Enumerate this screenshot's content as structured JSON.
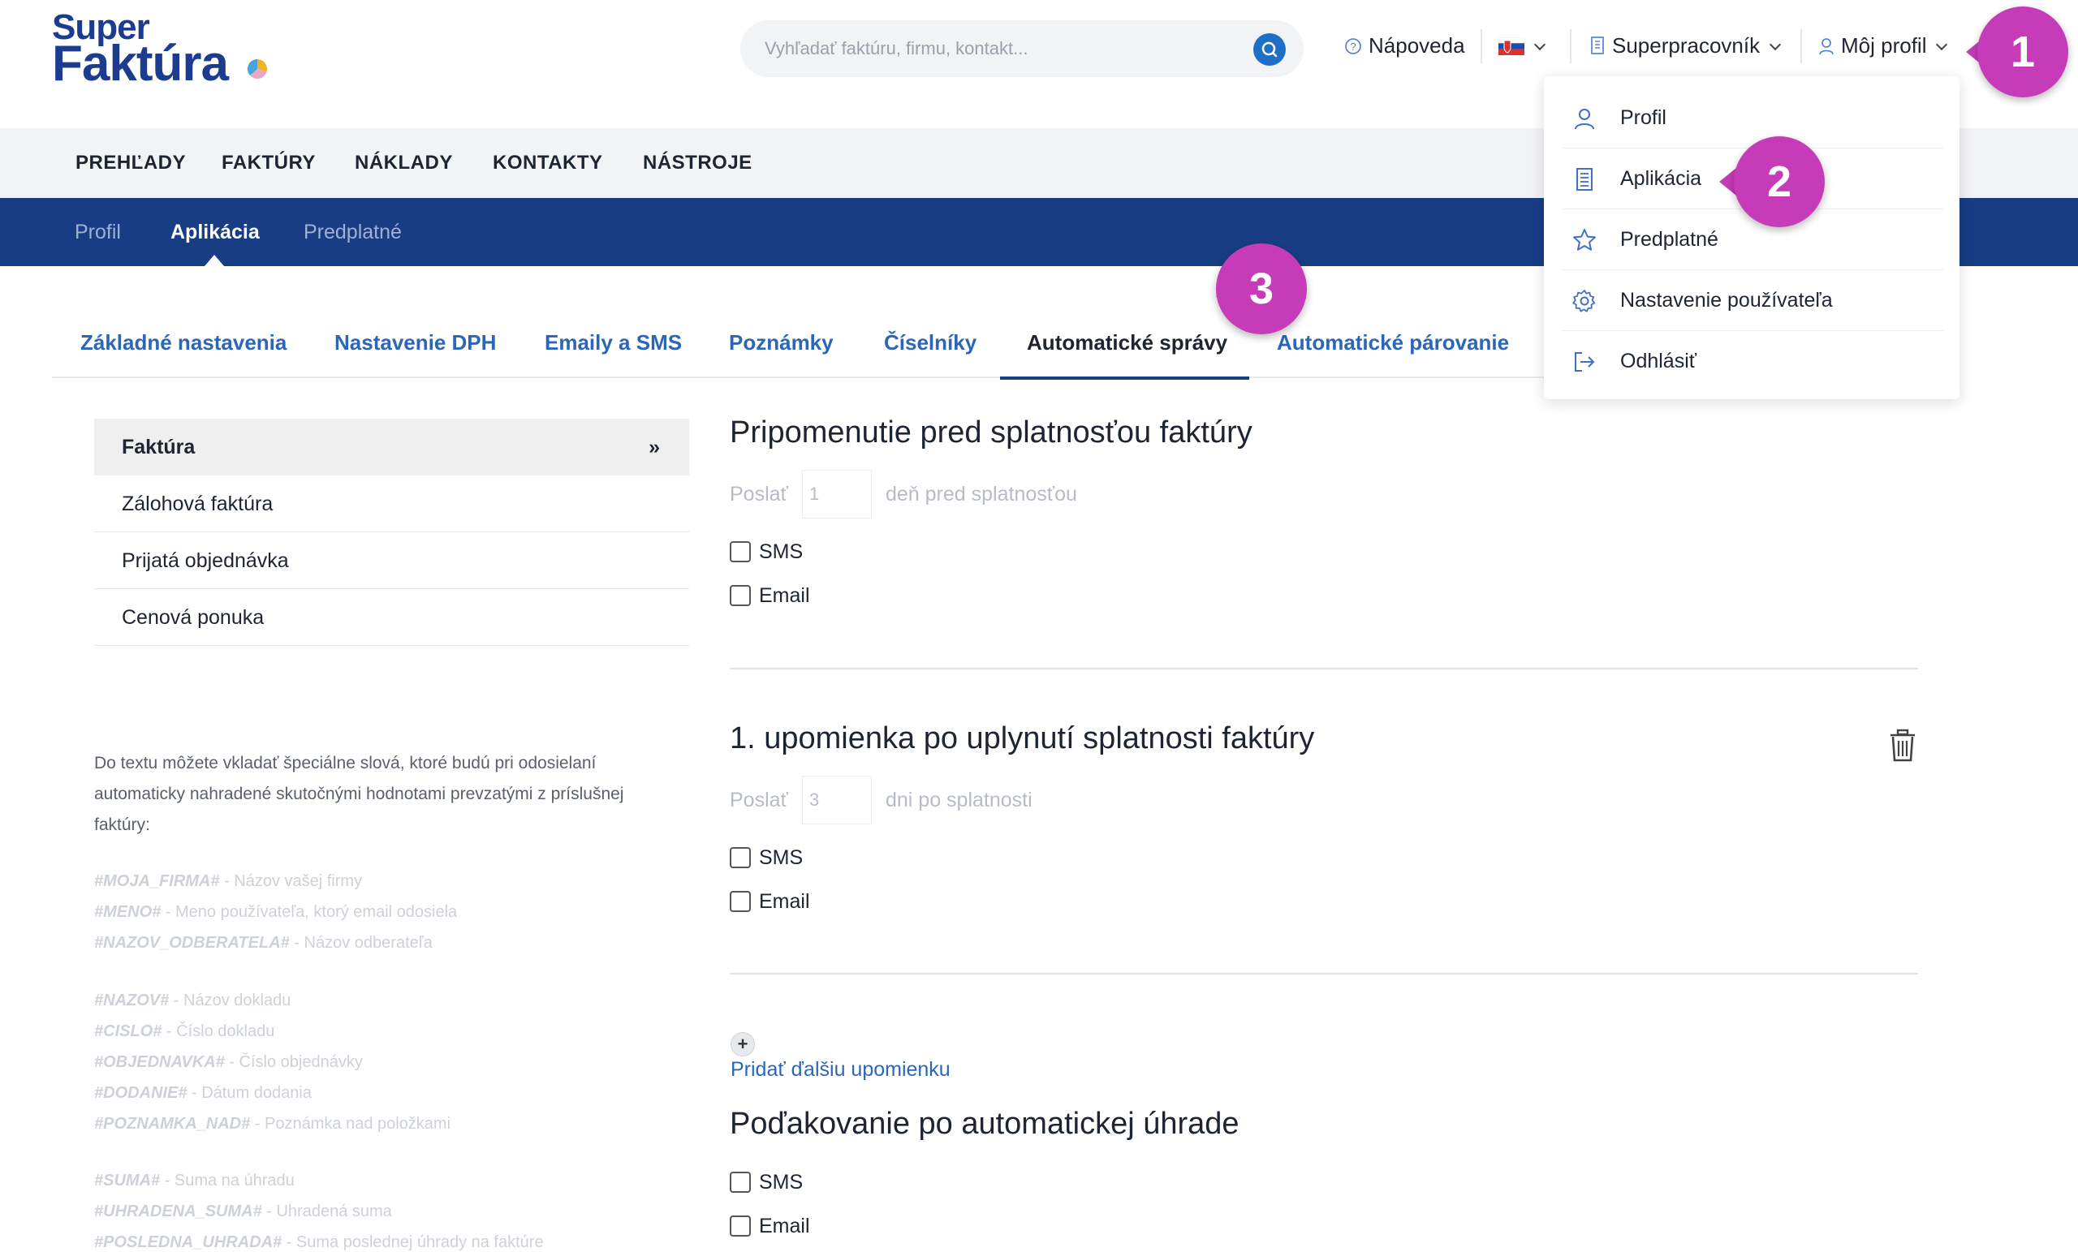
{
  "logo": {
    "line1": "Super",
    "line2": "Faktúra"
  },
  "search": {
    "placeholder": "Vyhľadať faktúru, firmu, kontakt..."
  },
  "header": {
    "help_label": "Nápoveda",
    "role_label": "Superpracovník",
    "profile_label": "Môj profil"
  },
  "main_nav": [
    "PREHĽADY",
    "FAKTÚRY",
    "NÁKLADY",
    "KONTAKTY",
    "NÁSTROJE"
  ],
  "sub_nav": [
    "Profil",
    "Aplikácia",
    "Predplatné"
  ],
  "tabs": [
    "Základné nastavenia",
    "Nastavenie DPH",
    "Emaily a SMS",
    "Poznámky",
    "Číselníky",
    "Automatické správy",
    "Automatické párovanie"
  ],
  "left_menu": {
    "items": [
      "Faktúra",
      "Zálohová faktúra",
      "Prijatá objednávka",
      "Cenová ponuka"
    ],
    "active_arrow": "»"
  },
  "help_text": "Do textu môžete vkladať špeciálne slová, ktoré budú pri odosielaní automaticky nahradené skutočnými hodnotami prevzatými z príslušnej faktúry:",
  "variables": [
    {
      "tag": "#MOJA_FIRMA#",
      "desc": " - Názov vašej firmy"
    },
    {
      "tag": "#MENO#",
      "desc": " - Meno používateľa, ktorý email odosiela"
    },
    {
      "tag": "#NAZOV_ODBERATELA#",
      "desc": " - Názov odberateľa"
    },
    {
      "tag": "#NAZOV#",
      "desc": " - Názov dokladu"
    },
    {
      "tag": "#CISLO#",
      "desc": " - Číslo dokladu"
    },
    {
      "tag": "#OBJEDNAVKA#",
      "desc": " - Číslo objednávky"
    },
    {
      "tag": "#DODANIE#",
      "desc": " - Dátum dodania"
    },
    {
      "tag": "#POZNAMKA_NAD#",
      "desc": " - Poznámka nad položkami"
    },
    {
      "tag": "#SUMA#",
      "desc": " - Suma na úhradu"
    },
    {
      "tag": "#UHRADENA_SUMA#",
      "desc": " - Uhradená suma"
    },
    {
      "tag": "#POSLEDNA_UHRADA#",
      "desc": " - Suma poslednej úhrady na faktúre"
    }
  ],
  "section1": {
    "title": "Pripomenutie pred splatnosťou faktúry",
    "send": "Poslať",
    "days": "1",
    "after": "deň pred splatnosťou",
    "sms": "SMS",
    "email": "Email"
  },
  "section2": {
    "title": "1. upomienka po uplynutí splatnosti faktúry",
    "send": "Poslať",
    "days": "3",
    "after": "dni po splatnosti",
    "sms": "SMS",
    "email": "Email"
  },
  "add_reminder": "Pridať ďalšiu upomienku",
  "section3": {
    "title": "Poďakovanie po automatickej úhrade",
    "sms": "SMS",
    "email": "Email"
  },
  "dropdown": [
    "Profil",
    "Aplikácia",
    "Predplatné",
    "Nastavenie používateľa",
    "Odhlásiť"
  ],
  "badges": [
    "1",
    "2",
    "3"
  ],
  "colors": {
    "brand_blue": "#183d84",
    "link_blue": "#2b66b8",
    "badge_magenta": "#c63bb7"
  }
}
